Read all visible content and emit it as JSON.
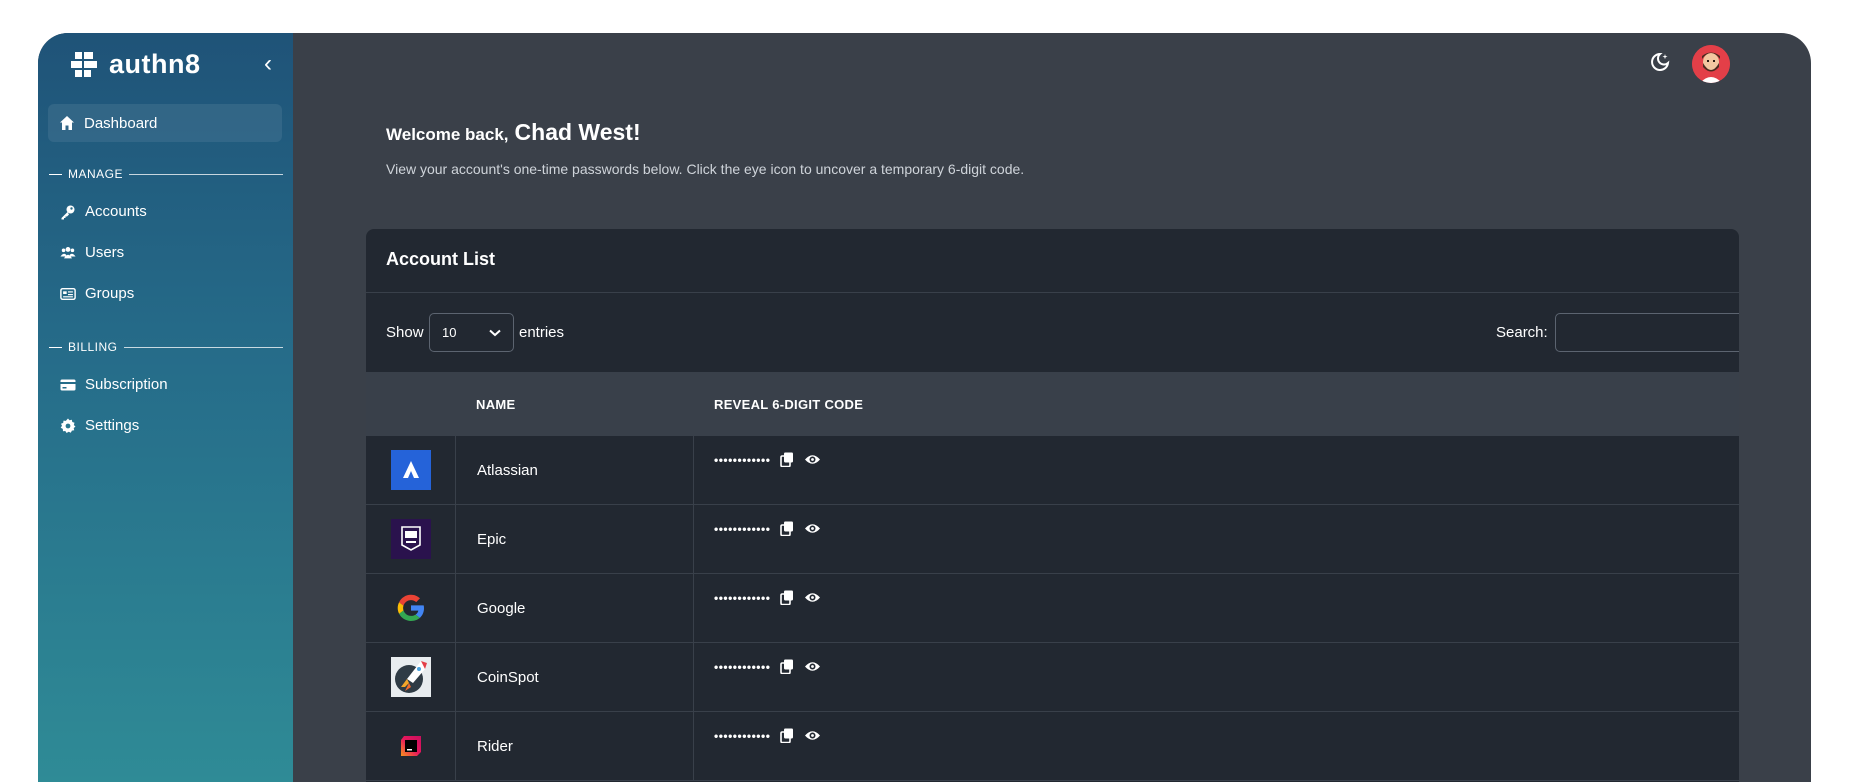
{
  "brand": {
    "name": "authn8",
    "collapse_glyph": "‹"
  },
  "sidebar": {
    "active": {
      "label": "Dashboard",
      "icon": "home-icon"
    },
    "sections": [
      {
        "title": "MANAGE",
        "items": [
          {
            "label": "Accounts",
            "icon": "key-icon"
          },
          {
            "label": "Users",
            "icon": "users-icon"
          },
          {
            "label": "Groups",
            "icon": "id-card-icon"
          }
        ]
      },
      {
        "title": "BILLING",
        "items": [
          {
            "label": "Subscription",
            "icon": "credit-card-icon"
          },
          {
            "label": "Settings",
            "icon": "gear-icon"
          }
        ]
      }
    ]
  },
  "header": {
    "welcome_prefix": "Welcome back,",
    "user_name": "Chad West!",
    "subtitle": "View your account's one-time passwords below. Click the eye icon to uncover a temporary 6-digit code."
  },
  "card": {
    "title": "Account List",
    "show_label": "Show",
    "entries_value": "10",
    "entries_label": "entries",
    "search_label": "Search:"
  },
  "table": {
    "columns": [
      "NAME",
      "REVEAL 6-DIGIT CODE"
    ],
    "masked_code": "••••••••••••",
    "rows": [
      {
        "name": "Atlassian",
        "logo": "atlassian-logo"
      },
      {
        "name": "Epic",
        "logo": "epic-games-logo"
      },
      {
        "name": "Google",
        "logo": "google-logo"
      },
      {
        "name": "CoinSpot",
        "logo": "coinspot-logo"
      },
      {
        "name": "Rider",
        "logo": "rider-logo"
      }
    ]
  },
  "colors": {
    "sidebar_top": "#1f5378",
    "sidebar_bottom": "#2f8b96",
    "content_bg": "#3a4049",
    "card_bg": "#222831",
    "accent_red": "#e33f48"
  }
}
